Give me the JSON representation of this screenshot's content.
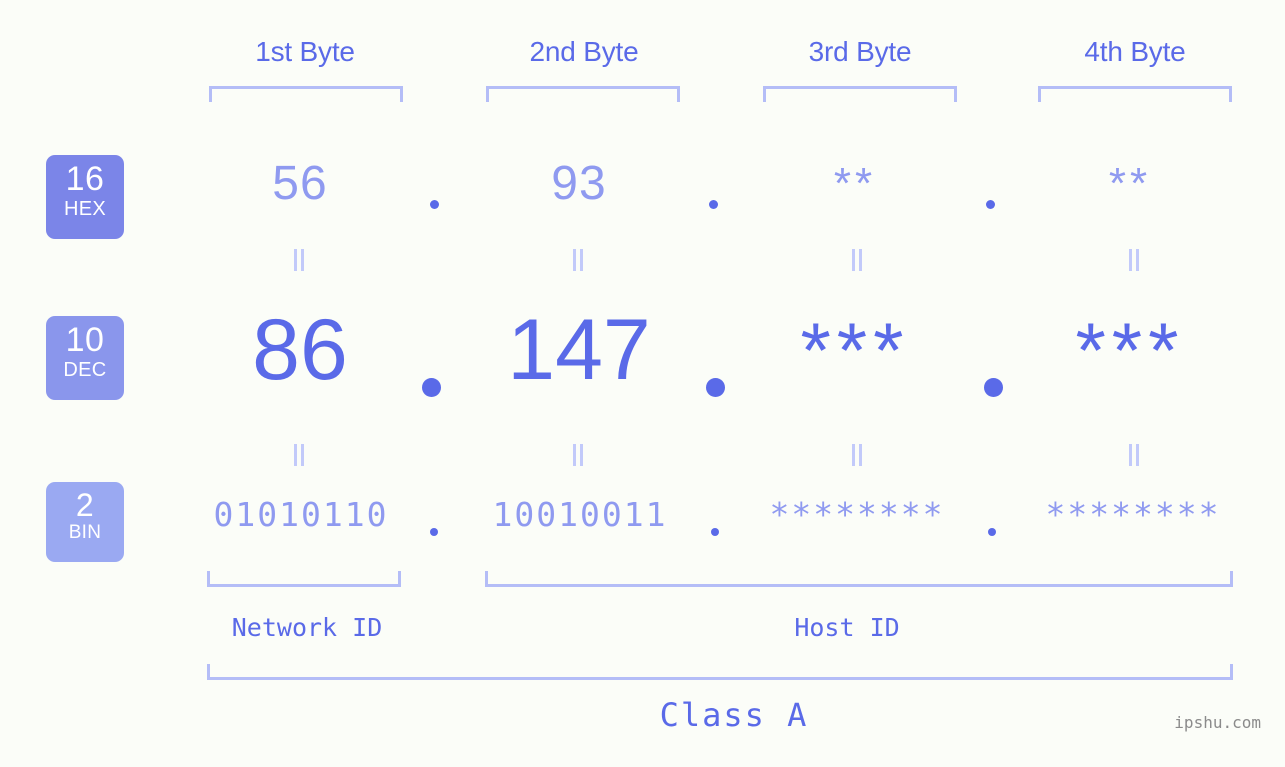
{
  "page": {
    "background_color": "#fbfdf8",
    "accent_color": "#5a6ae8",
    "accent_light_color": "#8f9af0",
    "bracket_color": "#b4bdf7"
  },
  "byte_headers": [
    {
      "label": "1st Byte"
    },
    {
      "label": "2nd Byte"
    },
    {
      "label": "3rd Byte"
    },
    {
      "label": "4th Byte"
    }
  ],
  "bases": [
    {
      "id": "hex",
      "number": "16",
      "name": "HEX",
      "color": "#7b85e8"
    },
    {
      "id": "dec",
      "number": "10",
      "name": "DEC",
      "color": "#8a96ec"
    },
    {
      "id": "bin",
      "number": "2",
      "name": "BIN",
      "color": "#9aa9f2"
    }
  ],
  "rows": {
    "hex": {
      "values": [
        "56",
        "93",
        "**",
        "**"
      ],
      "separators": [
        ".",
        ".",
        "."
      ]
    },
    "dec": {
      "values": [
        "86",
        "147",
        "***",
        "***"
      ],
      "separators": [
        ".",
        ".",
        "."
      ]
    },
    "bin": {
      "values": [
        "01010110",
        "10010011",
        "********",
        "********"
      ],
      "separators": [
        ".",
        ".",
        "."
      ]
    }
  },
  "equivalence_marks": {
    "symbol": "=",
    "rows": [
      "hex-to-dec",
      "dec-to-bin"
    ],
    "count_per_row": 4
  },
  "id_segments": [
    {
      "label": "Network ID"
    },
    {
      "label": "Host ID"
    }
  ],
  "class": {
    "label": "Class A"
  },
  "watermark": {
    "text": "ipshu.com"
  },
  "chart_data": {
    "type": "table",
    "title": "IP Address Byte Breakdown - Class A",
    "columns": [
      "1st Byte",
      "2nd Byte",
      "3rd Byte",
      "4th Byte"
    ],
    "rows": [
      {
        "base": "16 HEX",
        "values": [
          "56",
          "93",
          "**",
          "**"
        ]
      },
      {
        "base": "10 DEC",
        "values": [
          "86",
          "147",
          "***",
          "***"
        ]
      },
      {
        "base": "2 BIN",
        "values": [
          "01010110",
          "10010011",
          "********",
          "********"
        ]
      }
    ],
    "network_id_bytes": 1,
    "host_id_bytes": 3,
    "ip_class": "Class A"
  }
}
